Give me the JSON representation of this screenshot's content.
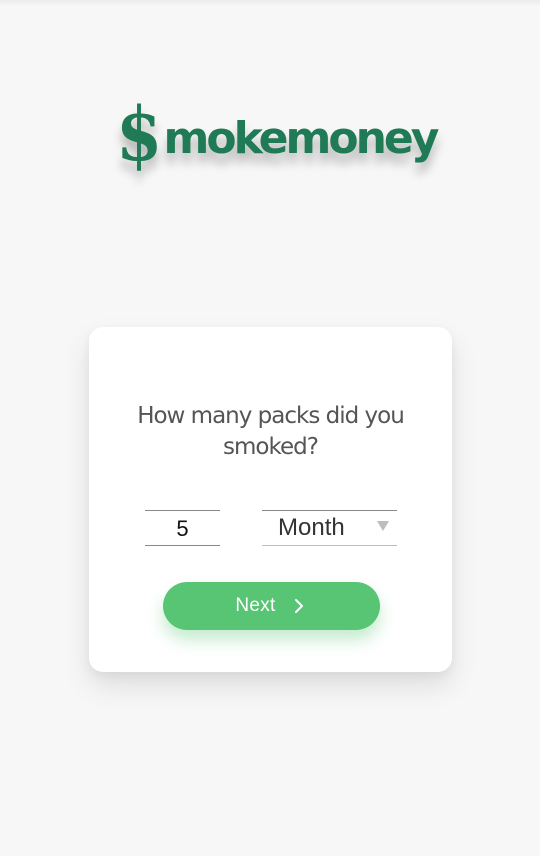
{
  "logo": {
    "symbol": "$",
    "word": "mokemoney",
    "color": "#1f7a55"
  },
  "card": {
    "question": "How many packs did you smoked?",
    "quantity_value": "5",
    "period_selected": "Month",
    "next_label": "Next",
    "next_icon": "chevron-right-icon",
    "accent": "#58c575"
  }
}
